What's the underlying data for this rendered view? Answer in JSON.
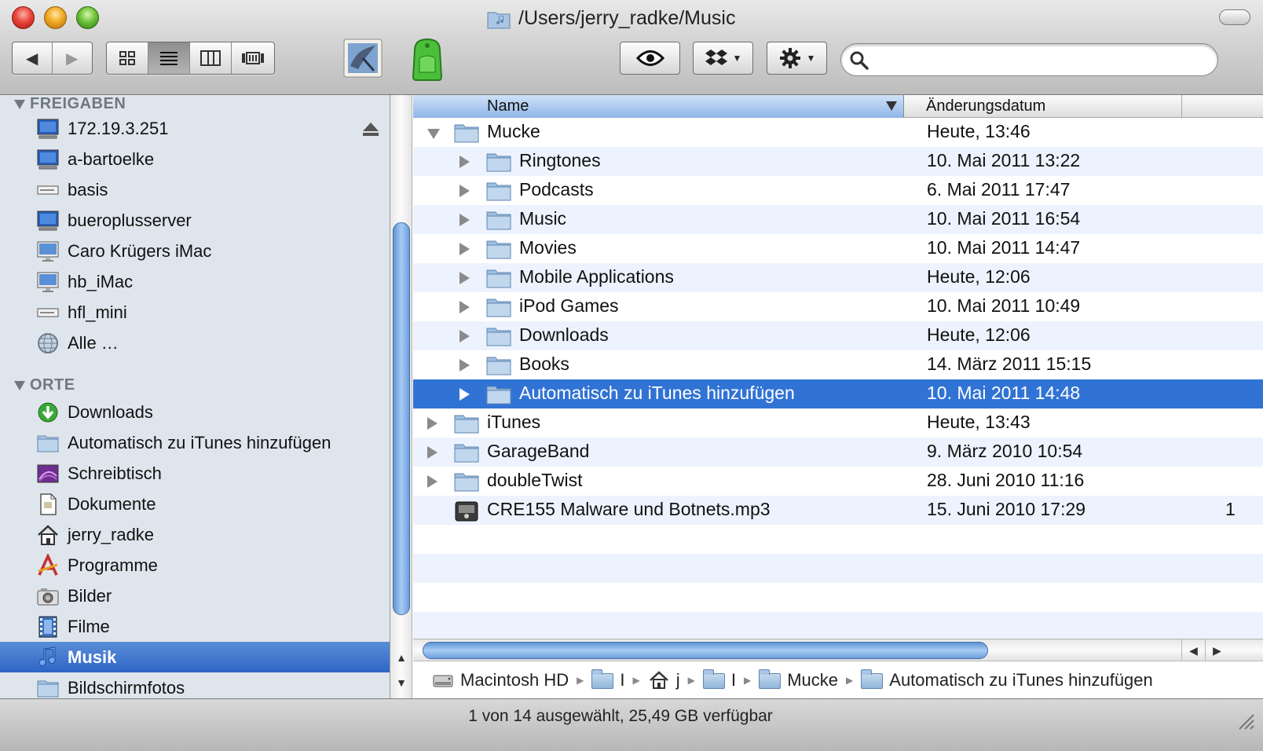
{
  "window": {
    "title": "/Users/jerry_radke/Music"
  },
  "toolbar": {
    "back_label": "◀",
    "forward_label": "▶",
    "view_modes": [
      "icon-view",
      "list-view",
      "column-view",
      "cover-flow-view"
    ],
    "search_placeholder": ""
  },
  "sidebar": {
    "shared_header": "FREIGABEN",
    "shared": [
      {
        "label": "172.19.3.251",
        "icon": "network-computer-icon"
      },
      {
        "label": "a-bartoelke",
        "icon": "network-computer-icon"
      },
      {
        "label": "basis",
        "icon": "server-icon"
      },
      {
        "label": "bueroplusserver",
        "icon": "network-computer-icon"
      },
      {
        "label": "Caro Krügers iMac",
        "icon": "imac-icon"
      },
      {
        "label": "hb_iMac",
        "icon": "imac-icon"
      },
      {
        "label": "hfl_mini",
        "icon": "server-icon"
      },
      {
        "label": "Alle …",
        "icon": "globe-icon"
      }
    ],
    "places_header": "ORTE",
    "places": [
      {
        "label": "Downloads",
        "icon": "downloads-icon"
      },
      {
        "label": "Automatisch zu iTunes hinzufügen",
        "icon": "folder-icon"
      },
      {
        "label": "Schreibtisch",
        "icon": "desktop-icon"
      },
      {
        "label": "Dokumente",
        "icon": "documents-icon"
      },
      {
        "label": "jerry_radke",
        "icon": "home-icon"
      },
      {
        "label": "Programme",
        "icon": "applications-icon"
      },
      {
        "label": "Bilder",
        "icon": "pictures-icon"
      },
      {
        "label": "Filme",
        "icon": "movies-icon"
      },
      {
        "label": "Musik",
        "icon": "music-icon",
        "selected": true
      },
      {
        "label": "Bildschirmfotos",
        "icon": "folder-icon"
      }
    ]
  },
  "columns": {
    "name": "Name",
    "date": "Änderungsdatum"
  },
  "files": [
    {
      "name": "Mucke",
      "date": "Heute, 13:46",
      "level": 0,
      "expanded": true
    },
    {
      "name": "Ringtones",
      "date": "10. Mai 2011 13:22",
      "level": 1
    },
    {
      "name": "Podcasts",
      "date": "6. Mai 2011 17:47",
      "level": 1
    },
    {
      "name": "Music",
      "date": "10. Mai 2011 16:54",
      "level": 1
    },
    {
      "name": "Movies",
      "date": "10. Mai 2011 14:47",
      "level": 1
    },
    {
      "name": "Mobile Applications",
      "date": "Heute, 12:06",
      "level": 1
    },
    {
      "name": "iPod Games",
      "date": "10. Mai 2011 10:49",
      "level": 1
    },
    {
      "name": "Downloads",
      "date": "Heute, 12:06",
      "level": 1
    },
    {
      "name": "Books",
      "date": "14. März 2011 15:15",
      "level": 1
    },
    {
      "name": "Automatisch zu iTunes hinzufügen",
      "date": "10. Mai 2011 14:48",
      "level": 1,
      "selected": true
    },
    {
      "name": "iTunes",
      "date": "Heute, 13:43",
      "level": 0
    },
    {
      "name": "GarageBand",
      "date": "9. März 2010 10:54",
      "level": 0
    },
    {
      "name": "doubleTwist",
      "date": "28. Juni 2010 11:16",
      "level": 0
    },
    {
      "name": "CRE155 Malware und Botnets.mp3",
      "date": "15. Juni 2010 17:29",
      "level": 0,
      "file": true,
      "trail": "1"
    }
  ],
  "pathbar": {
    "disk": "Macintosh HD",
    "users": "I",
    "home": "j",
    "music": "I",
    "mucke": "Mucke",
    "current": "Automatisch zu iTunes hinzufügen"
  },
  "status": {
    "text": "1 von 14 ausgewählt, 25,49 GB verfügbar"
  },
  "colors": {
    "selection": "#3173d4",
    "sidebar_bg": "#dfe5ec",
    "row_alt": "#edf3fe"
  }
}
